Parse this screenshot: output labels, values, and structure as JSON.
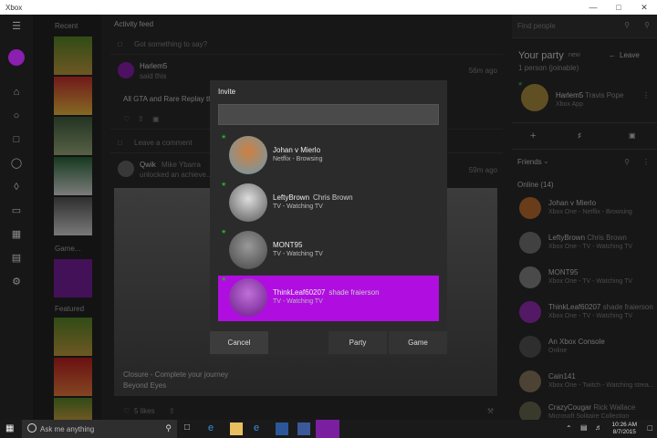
{
  "window": {
    "title": "Xbox"
  },
  "recent": {
    "label": "Recent",
    "games_label": "Game...",
    "featured_label": "Featured"
  },
  "feed": {
    "header": "Activity feed",
    "say_placeholder": "Got something to say?",
    "post1": {
      "user": "Harlem5",
      "action": "said this",
      "time": "56m ago",
      "text": "All GTA and Rare Replay that"
    },
    "comment_placeholder": "Leave a comment",
    "post2": {
      "user": "Qwik",
      "realname": "Mike Ybarra",
      "action": "unlocked an achieve...",
      "time": "59m ago"
    },
    "achievement": {
      "title": "Closure - Complete your journey",
      "game": "Beyond Eyes"
    },
    "likes": "5 likes"
  },
  "party": {
    "title": "Your party",
    "new_label": "new",
    "leave_label": "Leave",
    "count": "1 person (joinable)",
    "member": {
      "name": "Harlem5",
      "realname": "Travis Pope",
      "status": "Xbox App"
    }
  },
  "friends": {
    "search_placeholder": "Find people",
    "header": "Friends",
    "online_label": "Online (14)",
    "list": [
      {
        "name": "Johan v Mierlo",
        "realname": "",
        "status": "Xbox One - Netflix - Browsing"
      },
      {
        "name": "LeftyBrown",
        "realname": "Chris Brown",
        "status": "Xbox One - TV - Watching TV"
      },
      {
        "name": "MONT95",
        "realname": "",
        "status": "Xbox One - TV - Watching TV"
      },
      {
        "name": "ThinkLeaf60207",
        "realname": "shade fraierson",
        "status": "Xbox One - TV - Watching TV"
      },
      {
        "name": "An Xbox Console",
        "realname": "",
        "status": "Online"
      },
      {
        "name": "Cain141",
        "realname": "",
        "status": "Xbox One - Twitch - Watching strea..."
      },
      {
        "name": "CrazyCougar",
        "realname": "Rick Wallace",
        "status": "Microsoft Solitaire Collection"
      }
    ]
  },
  "dialog": {
    "title": "Invite",
    "rows": [
      {
        "name": "Johan v Mierlo",
        "realname": "",
        "status": "Netflix - Browsing"
      },
      {
        "name": "LeftyBrown",
        "realname": "Chris Brown",
        "status": "TV - Watching TV"
      },
      {
        "name": "MONT95",
        "realname": "",
        "status": "TV - Watching TV"
      },
      {
        "name": "ThinkLeaf60207",
        "realname": "shade fraierson",
        "status": "TV - Watching TV"
      }
    ],
    "cancel_label": "Cancel",
    "party_label": "Party",
    "game_label": "Game"
  },
  "taskbar": {
    "search_placeholder": "Ask me anything",
    "time": "10:26 AM",
    "date": "8/7/2015"
  },
  "colors": {
    "accent": "#b00ee0",
    "online": "#2aa72a"
  }
}
